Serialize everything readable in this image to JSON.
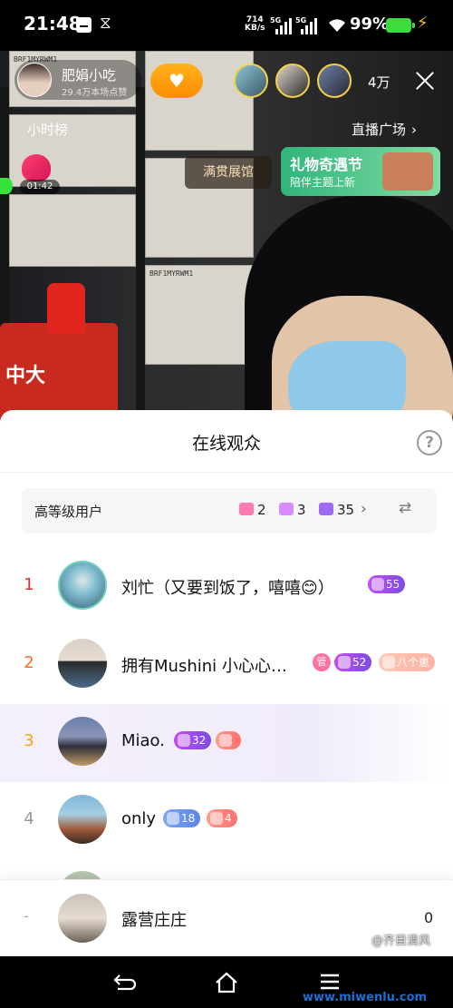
{
  "status_bar": {
    "time": "21:48",
    "net_speed_value": "714",
    "net_speed_unit": "KB/s",
    "sim1": "5G",
    "sim2": "5G",
    "battery": "99%"
  },
  "stream": {
    "anchor_name": "肥娟小吃",
    "anchor_likes": "29.4万本场点赞",
    "viewer_total": "4万",
    "hour_rank": "小时榜",
    "live_square": "直播广场",
    "timer": "01:42",
    "honor_hall": "满贯展馆",
    "gift_banner_title": "礼物奇遇节",
    "gift_banner_sub": "陪伴主题上新",
    "box_label": "BRF1MYRWM1",
    "machine_label": "中大"
  },
  "sheet": {
    "title": "在线观众",
    "help": "?",
    "level_label": "高等级用户",
    "level_counts": [
      {
        "icon": "crown-icon",
        "value": "2",
        "color": "#ff7ab0"
      },
      {
        "icon": "gem-icon",
        "value": "3",
        "color": "#d78bff"
      },
      {
        "icon": "hexagon-icon",
        "value": "35",
        "color": "#a06cf5"
      }
    ]
  },
  "viewers": [
    {
      "rank": "1",
      "name": "刘忙（又要到饭了，嘻嘻😊）",
      "badges": [
        {
          "text": "55",
          "style": "purple"
        }
      ],
      "avatar_colors": [
        "#7fbcd0",
        "#3a6070"
      ]
    },
    {
      "rank": "2",
      "name": "拥有Mushini 小心心…",
      "badges": [
        {
          "text": "管",
          "style": "admin"
        },
        {
          "text": "52",
          "style": "purple"
        },
        {
          "text": "八个崽",
          "style": "peach"
        }
      ],
      "avatar_colors": [
        "#d8d0c8",
        "#2a2a2a"
      ]
    },
    {
      "rank": "3",
      "name": "Miao.",
      "badges": [
        {
          "text": "32",
          "style": "purple"
        },
        {
          "text": "",
          "style": "pink"
        }
      ],
      "avatar_colors": [
        "#6a7fa8",
        "#2e2f3a"
      ]
    },
    {
      "rank": "4",
      "name": "only",
      "badges": [
        {
          "text": "18",
          "style": "blue"
        },
        {
          "text": "4",
          "style": "pink"
        }
      ],
      "avatar_colors": [
        "#7eb6d8",
        "#a05a3a"
      ]
    }
  ],
  "me": {
    "rank": "-",
    "name": "露营庄庄",
    "count": "0"
  },
  "watermark": "@齐目清风",
  "site": "www.miwenlu.com"
}
